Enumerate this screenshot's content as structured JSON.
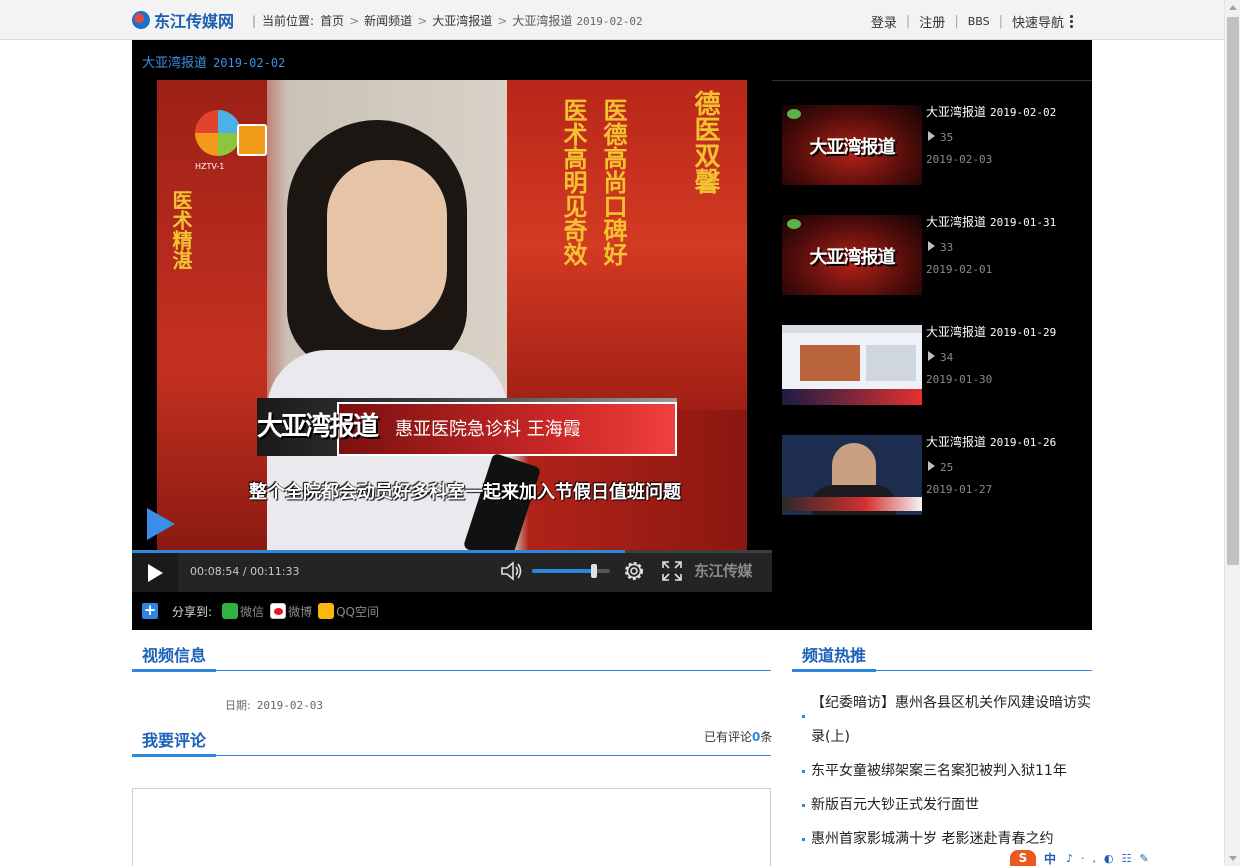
{
  "header": {
    "logo_text": "东江传媒网",
    "location_label": "当前位置:",
    "breadcrumbs": [
      "首页",
      "新闻频道",
      "大亚湾报道"
    ],
    "current_page": "大亚湾报道",
    "current_date": "2019-02-02",
    "links": [
      "登录",
      "注册",
      "BBS",
      "快速导航"
    ]
  },
  "player": {
    "title": "大亚湾报道",
    "title_date": "2019-02-02",
    "time": "00:08:54 / 00:11:33",
    "progress": 0.77,
    "volume": 0.8,
    "brand": "东江传媒",
    "frame": {
      "channel": "HZTV-1",
      "show_name": "大亚湾报道",
      "caption": "惠亚医院急诊科  王海霞",
      "subtitle": "整个全院都会动员好多科室一起来加入节假日值班问题",
      "banner_left": "医术精湛",
      "banner_mid1": "医术高明见奇效",
      "banner_mid2": "医德高尚口碑好",
      "banner_right": "德医双馨"
    }
  },
  "share": {
    "label": "分享到:",
    "items": [
      "微信",
      "微博",
      "QQ空间"
    ]
  },
  "related": [
    {
      "title": "大亚湾报道",
      "date_in_title": "2019-02-02",
      "views": "35",
      "date": "2019-02-03",
      "thumb_text": "大亚湾报道"
    },
    {
      "title": "大亚湾报道",
      "date_in_title": "2019-01-31",
      "views": "33",
      "date": "2019-02-01",
      "thumb_text": "大亚湾报道"
    },
    {
      "title": "大亚湾报道",
      "date_in_title": "2019-01-29",
      "views": "34",
      "date": "2019-01-30",
      "thumb_text": ""
    },
    {
      "title": "大亚湾报道",
      "date_in_title": "2019-01-26",
      "views": "25",
      "date": "2019-01-27",
      "thumb_text": ""
    }
  ],
  "video_info": {
    "heading": "视频信息",
    "date_label": "日期:",
    "date_value": "2019-02-03"
  },
  "comments": {
    "heading": "我要评论",
    "count_prefix": "已有评论",
    "count": "0",
    "count_suffix": "条"
  },
  "hot": {
    "heading": "频道热推",
    "items": [
      "【纪委暗访】惠州各县区机关作风建设暗访实录(上)",
      "东平女童被绑架案三名案犯被判入狱11年",
      "新版百元大钞正式发行面世",
      "惠州首家影城满十岁  老影迷赴青春之约"
    ]
  },
  "ime": {
    "logo": "S",
    "mode": "中",
    "symbols": "♪·,◐☷✎"
  },
  "colors": {
    "accent": "#2d87e0",
    "title_blue": "#1b62b8",
    "player_bg": "#000000"
  }
}
